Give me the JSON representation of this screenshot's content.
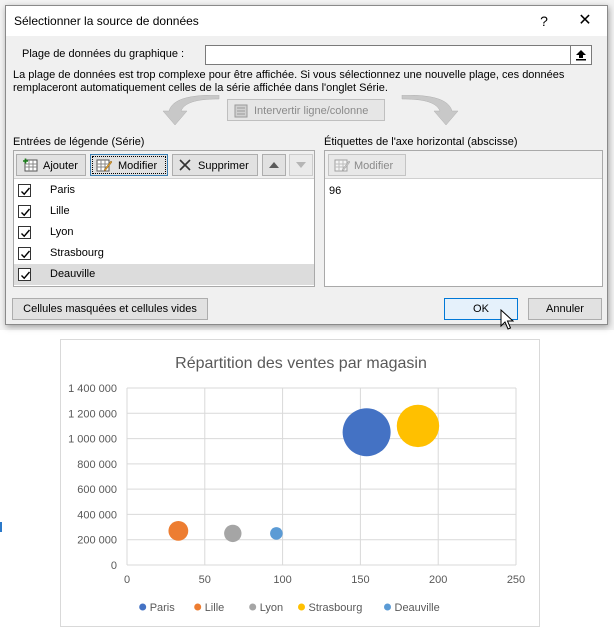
{
  "dialog": {
    "title": "Sélectionner la source de données",
    "help_label": "?",
    "close_label": "✕",
    "range_label": "Plage de données du graphique :",
    "range_value": "",
    "warning": "La plage de données est trop complexe pour être affichée. Si vous sélectionnez une nouvelle plage, ces données remplaceront automatiquement celles de la série affichée dans l'onglet Série.",
    "switch_label": "Intervertir ligne/colonne",
    "legend_heading": "Entrées de légende (Série)",
    "axis_heading": "Étiquettes de l'axe horizontal (abscisse)",
    "buttons": {
      "add": "Ajouter",
      "edit": "Modifier",
      "delete": "Supprimer",
      "axis_edit": "Modifier",
      "hidden_cells": "Cellules masquées et cellules vides",
      "ok": "OK",
      "cancel": "Annuler"
    },
    "series": [
      {
        "name": "Paris",
        "checked": true
      },
      {
        "name": "Lille",
        "checked": true
      },
      {
        "name": "Lyon",
        "checked": true
      },
      {
        "name": "Strasbourg",
        "checked": true
      },
      {
        "name": "Deauville",
        "checked": true,
        "selected": true
      }
    ],
    "axis_labels": [
      "96"
    ]
  },
  "chart_data": {
    "type": "bubble",
    "title": "Répartition des ventes par magasin",
    "x_ticks": [
      "0",
      "50",
      "100",
      "150",
      "200",
      "250"
    ],
    "y_ticks": [
      "0",
      "200 000",
      "400 000",
      "600 000",
      "800 000",
      "1 000 000",
      "1 200 000",
      "1 400 000"
    ],
    "xlim": [
      0,
      250
    ],
    "ylim": [
      0,
      1400000
    ],
    "grid": true,
    "legend_position": "bottom",
    "series": [
      {
        "name": "Paris",
        "color": "#4472c4",
        "x": 154,
        "y": 1050000,
        "size": 100
      },
      {
        "name": "Lille",
        "color": "#ed7d31",
        "x": 33,
        "y": 270000,
        "size": 17
      },
      {
        "name": "Lyon",
        "color": "#a5a5a5",
        "x": 68,
        "y": 250000,
        "size": 13
      },
      {
        "name": "Strasbourg",
        "color": "#ffc000",
        "x": 187,
        "y": 1100000,
        "size": 78
      },
      {
        "name": "Deauville",
        "color": "#5b9bd5",
        "x": 96,
        "y": 250000,
        "size": 7
      }
    ]
  }
}
